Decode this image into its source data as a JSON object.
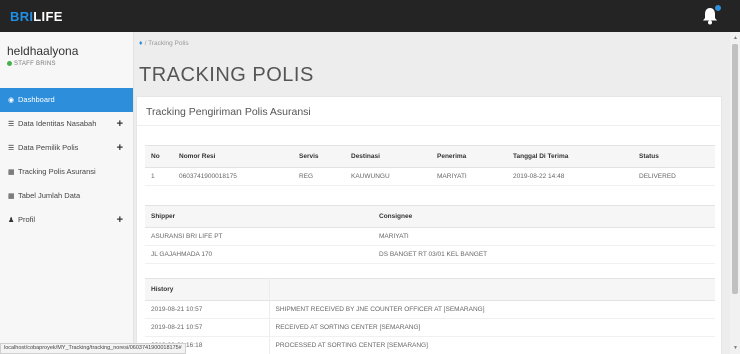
{
  "brand": {
    "part1": "BRI",
    "part2": "LIFE"
  },
  "user": {
    "name": "heldhaalyona",
    "role": "STAFF BRINS"
  },
  "nav": [
    {
      "label": "Dashboard",
      "icon": "dashboard-icon",
      "active": true
    },
    {
      "label": "Data Identitas Nasabah",
      "icon": "list-icon",
      "has_plus": true
    },
    {
      "label": "Data Pemilik Polis",
      "icon": "list-icon",
      "has_plus": true
    },
    {
      "label": "Tracking Polis Asuransi",
      "icon": "calendar-icon"
    },
    {
      "label": "Tabel Jumlah Data",
      "icon": "calendar-icon"
    },
    {
      "label": "Profil",
      "icon": "user-icon",
      "has_plus": true
    }
  ],
  "breadcrumb": "/ Tracking Polis",
  "page_title": "TRACKING POLIS",
  "panel_title": "Tracking Pengiriman Polis Asuransi",
  "shipment_table": {
    "headers": [
      "No",
      "Nomor Resi",
      "Servis",
      "Destinasi",
      "Penerima",
      "Tanggal Di Terima",
      "Status"
    ],
    "rows": [
      [
        "1",
        "0603741900018175",
        "REG",
        "KAUWUNGU",
        "MARIYATI",
        "2019-08-22 14:48",
        "DELIVERED"
      ]
    ]
  },
  "party_table": {
    "headers": [
      "Shipper",
      "Consignee"
    ],
    "rows": [
      [
        "ASURANSI BRI LIFE PT",
        "MARIYATI"
      ],
      [
        "JL GAJAHMADA 170",
        "DS BANGET RT 03/01 KEL BANGET"
      ]
    ]
  },
  "history_table": {
    "header": "History",
    "rows": [
      [
        "2019-08-21 10:57",
        "SHIPMENT RECEIVED BY JNE COUNTER OFFICER AT [SEMARANG]"
      ],
      [
        "2019-08-21 10:57",
        "RECEIVED AT SORTING CENTER [SEMARANG]"
      ],
      [
        "2019-08-21 16:18",
        "PROCESSED AT SORTING CENTER [SEMARANG]"
      ]
    ]
  },
  "status_url": "localhost/cobaproyek/MY_Tracking/tracking_noresi/0603741900018175#",
  "colors": {
    "accent": "#2d8fdb",
    "topbar": "#242424",
    "online": "#47b04b"
  }
}
